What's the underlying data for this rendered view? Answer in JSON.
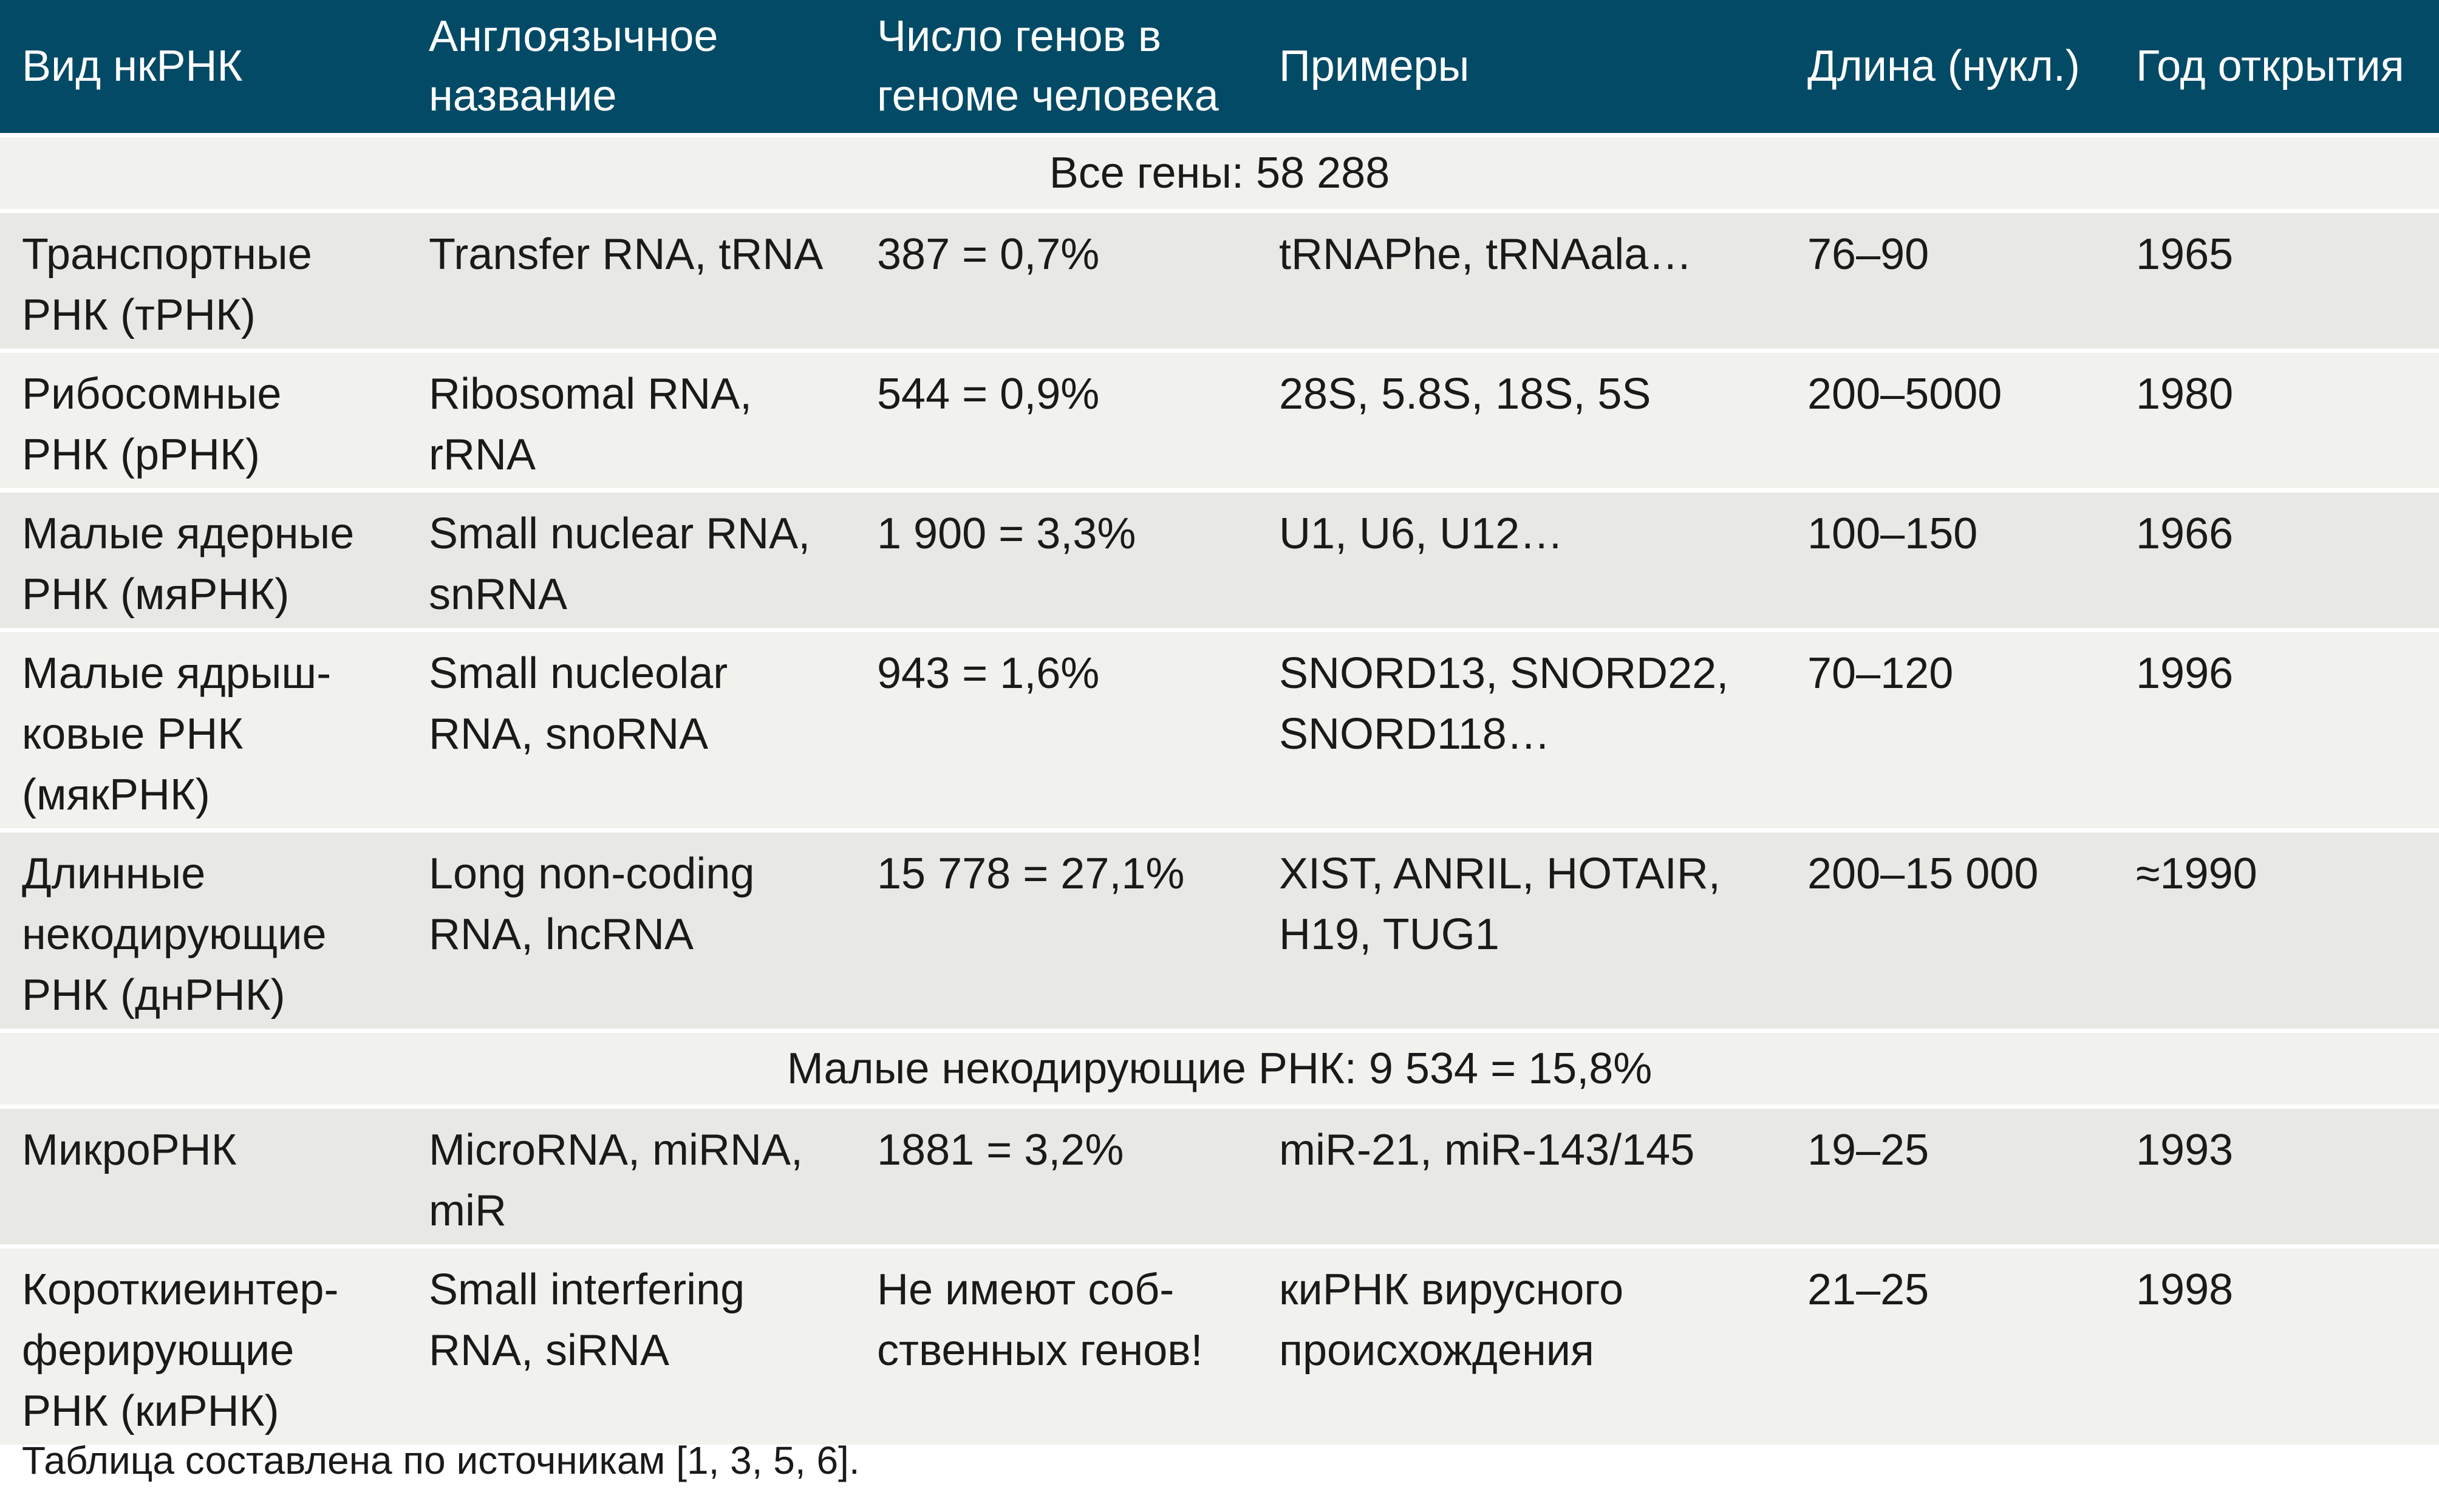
{
  "table": {
    "headers": [
      "Вид нкРНК",
      "Англоязычное\nназвание",
      "Число генов в\nгеноме человека",
      "Примеры",
      "Длина (нукл.)",
      "Год открытия"
    ],
    "section_all_genes": "Все гены: 58 288",
    "section_small_ncrna": "Малые некодирующие РНК: 9 534 = 15,8%",
    "rows": [
      {
        "type": "Транспортные\nРНК (тРНК)",
        "english": "Transfer RNA, tRNA",
        "genes": "387 = 0,7%",
        "examples": "tRNAPhe, tRNAala…",
        "length": "76–90",
        "year": "1965"
      },
      {
        "type": "Рибосомные\nРНК (рРНК)",
        "english": "Ribosomal RNA,\nrRNA",
        "genes": "544 = 0,9%",
        "examples": "28S, 5.8S, 18S, 5S",
        "length": "200–5000",
        "year": "1980"
      },
      {
        "type": "Малые ядерные\nРНК (мяРНК)",
        "english": "Small nuclear RNA,\nsnRNA",
        "genes": "1 900 = 3,3%",
        "examples": "U1, U6, U12…",
        "length": "100–150",
        "year": "1966"
      },
      {
        "type": "Малые ядрыш-\nковые РНК\n(мякРНК)",
        "english": "Small nucleolar\nRNA, snoRNA",
        "genes": "943 = 1,6%",
        "examples": "SNORD13, SNORD22,\nSNORD118…",
        "length": "70–120",
        "year": "1996"
      },
      {
        "type": "Длинные\nнекодирующие\nРНК (днРНК)",
        "english": "Long non-coding\nRNA, lncRNA",
        "genes": "15 778 = 27,1%",
        "examples": "XIST, ANRIL, HOTAIR,\nH19, TUG1",
        "length": "200–15 000",
        "year": "≈1990"
      },
      {
        "type": "МикроРНК",
        "english": "MicroRNA, miRNA,\nmiR",
        "genes": "1881 = 3,2%",
        "examples": "miR-21, miR-143/145",
        "length": "19–25",
        "year": "1993"
      },
      {
        "type": "Короткиеинтер-\nферирующие\nРНК (киРНК)",
        "english": "Small interfering\nRNA, siRNA",
        "genes": "Не имеют  соб-\nственных генов!",
        "examples": "киРНК вирусного\nпроисхождения",
        "length": "21–25",
        "year": "1998"
      }
    ]
  },
  "footnote": "Таблица составлена по источникам [1, 3, 5, 6].",
  "colors": {
    "header_bg": "#024a66",
    "header_text": "#ffffff",
    "row_odd_bg": "#e8e8e4",
    "row_even_bg": "#f1f1ed"
  }
}
